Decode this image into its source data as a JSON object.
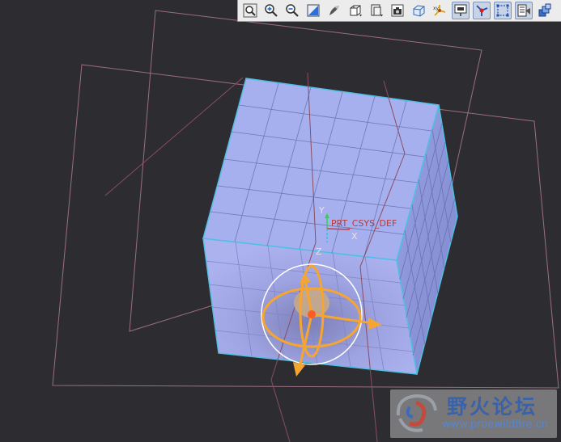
{
  "toolbar": {
    "buttons": [
      {
        "icon": "zoom-fit-icon",
        "active": false
      },
      {
        "icon": "zoom-in-icon",
        "active": false
      },
      {
        "icon": "zoom-out-icon",
        "active": false
      },
      {
        "icon": "repaint-icon",
        "active": false
      },
      {
        "icon": "shading-icon",
        "active": false
      },
      {
        "icon": "saved-views-icon",
        "active": false
      },
      {
        "icon": "view-manager-icon",
        "active": false
      },
      {
        "icon": "snapshot-icon",
        "active": false
      },
      {
        "icon": "orient-icon",
        "active": false
      },
      {
        "icon": "spin-center-icon",
        "active": false
      },
      {
        "icon": "datum-planes-icon",
        "active": true
      },
      {
        "icon": "datum-axes-icon",
        "active": true
      },
      {
        "icon": "datum-points-icon",
        "active": true
      },
      {
        "icon": "csys-display-icon",
        "active": true
      },
      {
        "icon": "annotation-display-icon",
        "active": false
      }
    ]
  },
  "viewport": {
    "background_color": "#2d2c30",
    "csys": {
      "name": "PRT_CSYS_DEF",
      "axis_x": "X",
      "axis_y": "Y",
      "axis_z": "Z"
    },
    "colors": {
      "face_top": "#a7b0ee",
      "face_right": "#8e98dc",
      "face_front": "#a3aae6",
      "edge": "#4fbfe6",
      "datum_plane": "#9a6e80",
      "dragger": "#f6a531"
    }
  },
  "watermark": {
    "title": "野火论坛",
    "url": "www.proewildfire.cn"
  }
}
